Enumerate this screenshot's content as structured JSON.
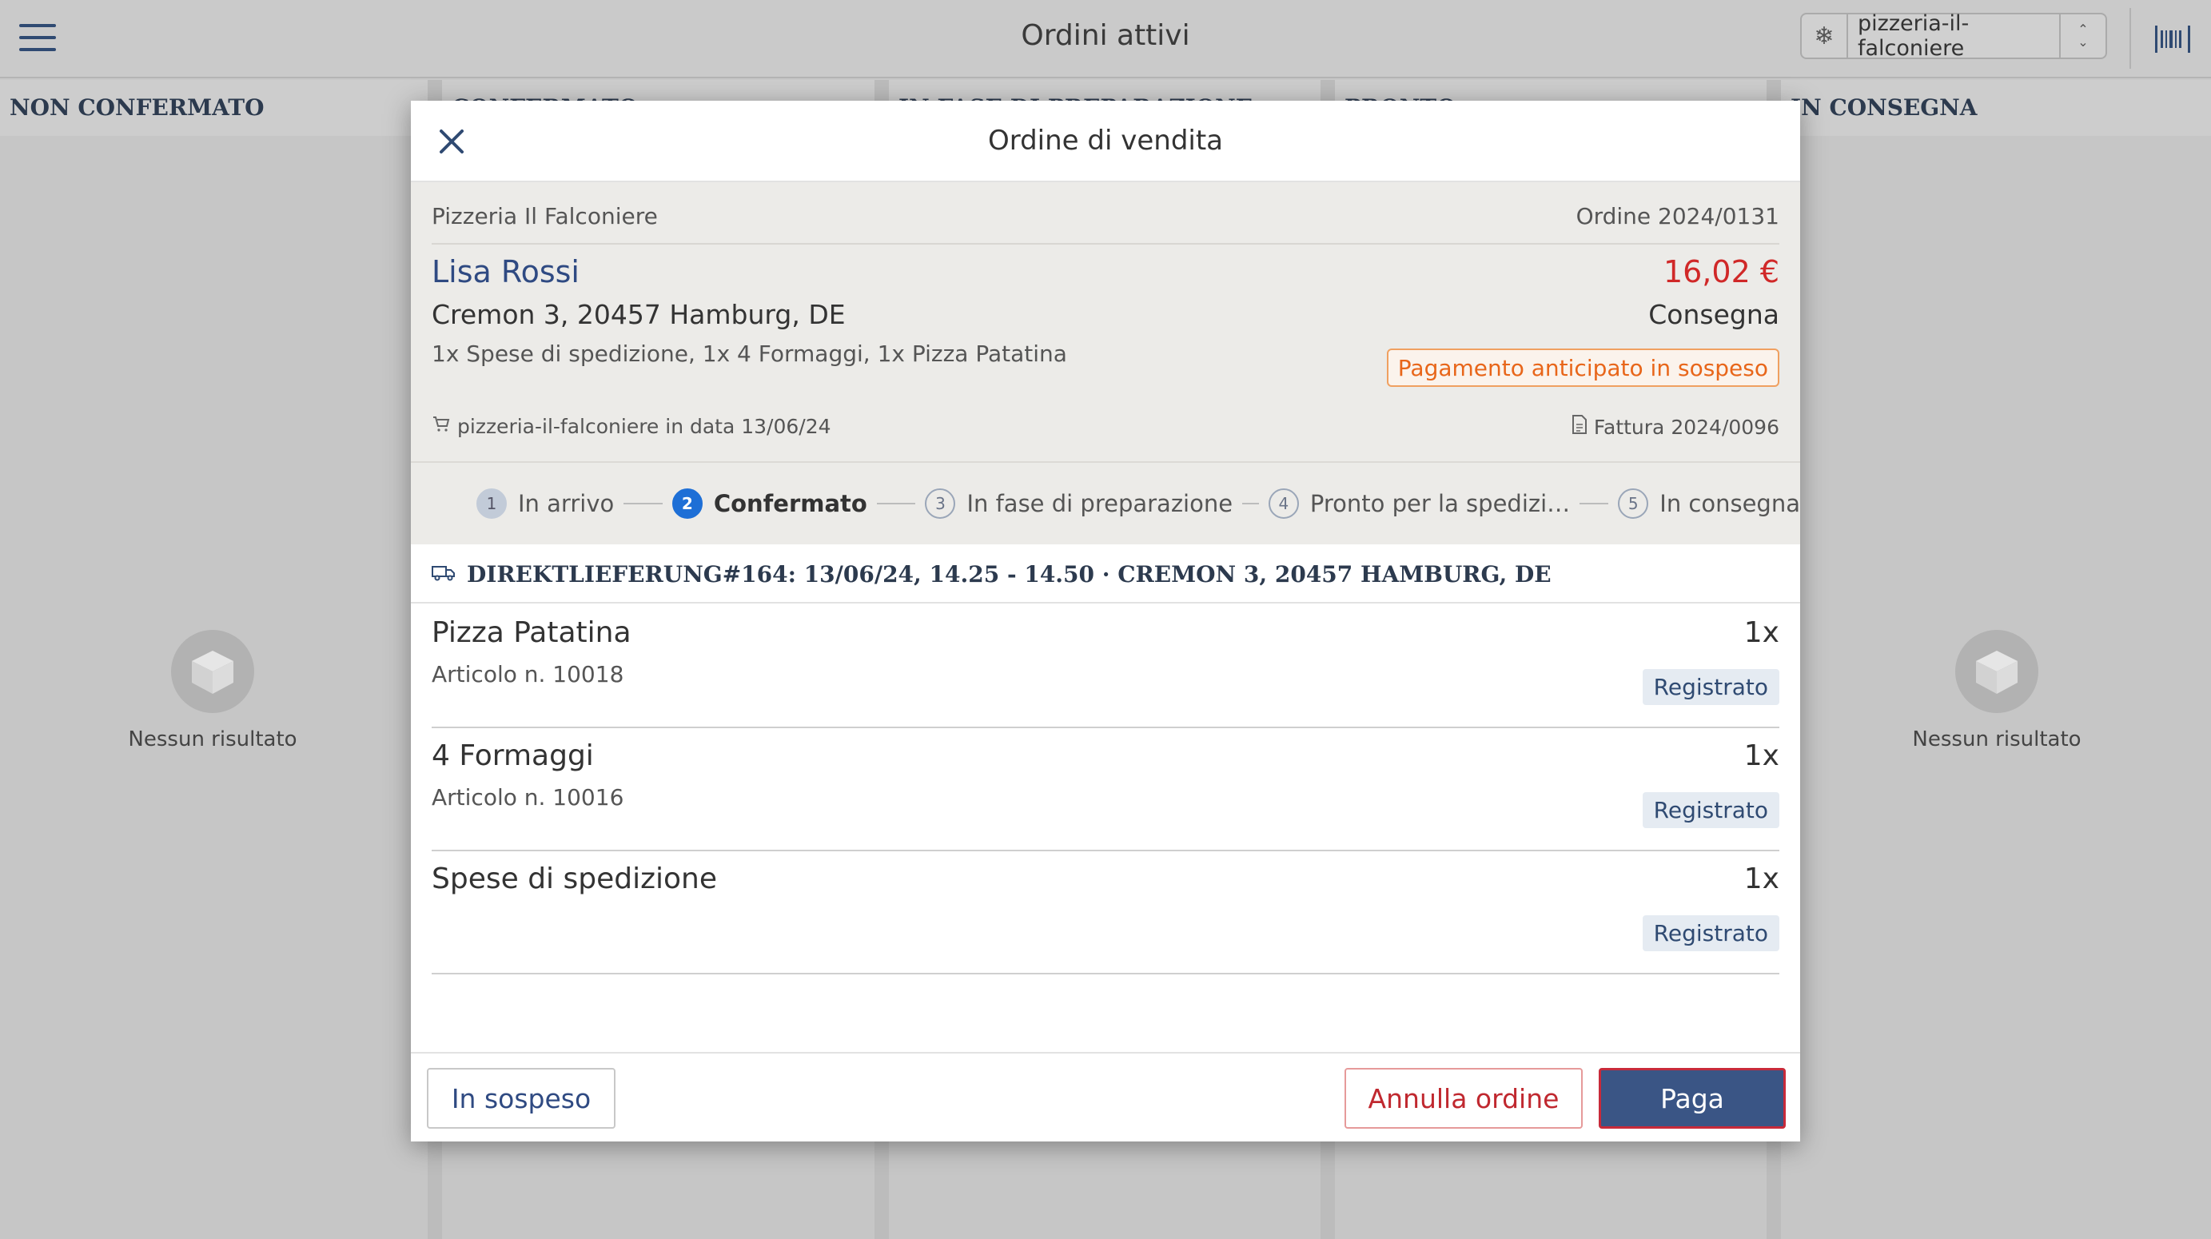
{
  "app": {
    "title": "Ordini attivi",
    "store": "pizzeria-il-falconiere"
  },
  "columns": [
    {
      "title": "NON CONFERMATO",
      "empty_label": "Nessun risultato"
    },
    {
      "title": "CONFERMATO",
      "empty_label": ""
    },
    {
      "title": "IN FASE DI PREPARAZIONE",
      "empty_label": ""
    },
    {
      "title": "PRONTO",
      "empty_label": ""
    },
    {
      "title": "IN CONSEGNA",
      "empty_label": "Nessun risultato"
    }
  ],
  "modal": {
    "title": "Ordine di vendita",
    "shop_name": "Pizzeria Il Falconiere",
    "order_number": "Ordine 2024/0131",
    "customer": "Lisa Rossi",
    "total": "16,02 €",
    "address": "Cremon 3, 20457 Hamburg, DE",
    "delivery_type": "Consegna",
    "items_summary": "1x Spese di spedizione, 1x 4 Formaggi, 1x Pizza Patatina",
    "payment_status": "Pagamento anticipato in sospeso",
    "source": "pizzeria-il-falconiere in data 13/06/24",
    "invoice": "Fattura 2024/0096",
    "steps": [
      {
        "num": "1",
        "label": "In arrivo"
      },
      {
        "num": "2",
        "label": "Confermato"
      },
      {
        "num": "3",
        "label": "In fase di preparazione"
      },
      {
        "num": "4",
        "label": "Pronto per la spedizi…"
      },
      {
        "num": "5",
        "label": "In consegna"
      }
    ],
    "delivery_line": "DIREKTLIEFERUNG#164: 13/06/24, 14.25 - 14.50 · CREMON 3, 20457 HAMBURG, DE",
    "lines": [
      {
        "name": "Pizza Patatina",
        "sku": "Articolo n. 10018",
        "qty": "1x",
        "status": "Registrato"
      },
      {
        "name": "4 Formaggi",
        "sku": "Articolo n. 10016",
        "qty": "1x",
        "status": "Registrato"
      },
      {
        "name": "Spese di spedizione",
        "sku": "",
        "qty": "1x",
        "status": "Registrato"
      }
    ],
    "buttons": {
      "suspend": "In sospeso",
      "cancel": "Annulla ordine",
      "pay": "Paga"
    }
  },
  "colors": {
    "accent": "#3a5585",
    "danger": "#d02828",
    "warning": "#e8661a",
    "step_active": "#1e6fd6"
  }
}
